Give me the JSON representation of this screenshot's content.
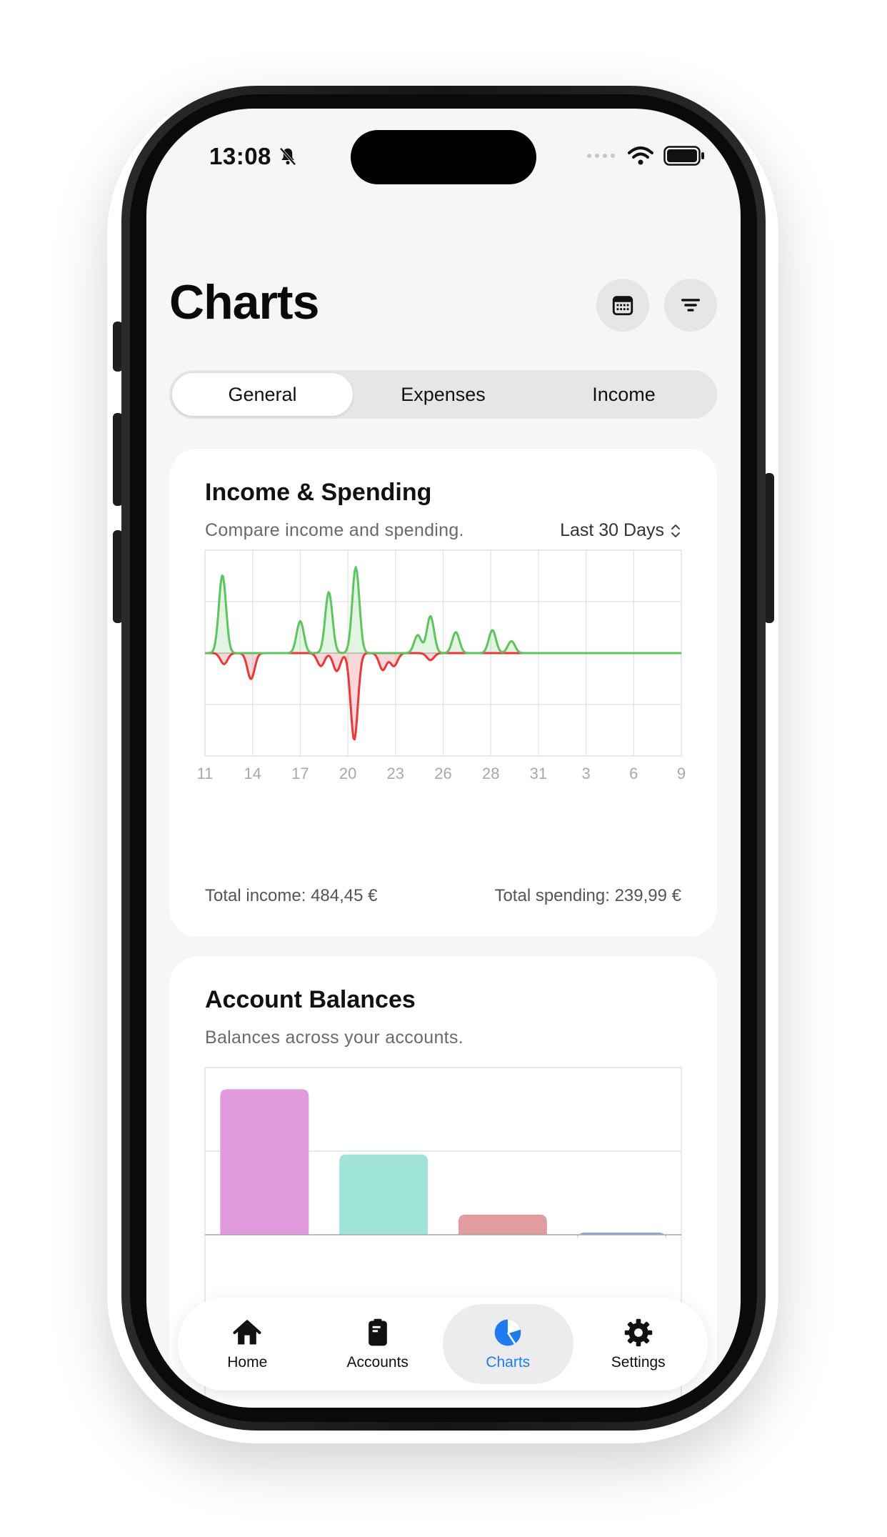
{
  "status_bar": {
    "time": "13:08"
  },
  "header": {
    "title": "Charts"
  },
  "segmented": {
    "items": [
      "General",
      "Expenses",
      "Income"
    ],
    "selected": "General"
  },
  "income_card": {
    "title": "Income & Spending",
    "subtitle": "Compare income and spending.",
    "range_label": "Last 30 Days",
    "total_income": "Total income: 484,45 €",
    "total_spending": "Total spending: 239,99 €"
  },
  "balances_card": {
    "title": "Account Balances",
    "subtitle": "Balances across your accounts."
  },
  "tabbar": {
    "home": "Home",
    "accounts": "Accounts",
    "charts": "Charts",
    "settings": "Settings",
    "selected": "Charts"
  },
  "colors": {
    "income_line": "#5ec45e",
    "spending_line": "#e8383a",
    "accent": "#1e7cf0",
    "bar_colors": [
      "#e19bdc",
      "#a0e4d8",
      "#e19c9d",
      "#8fa5e0"
    ]
  },
  "chart_data": [
    {
      "type": "area",
      "title": "Income & Spending",
      "x_tick_labels": [
        "11",
        "14",
        "17",
        "20",
        "23",
        "26",
        "28",
        "31",
        "3",
        "6",
        "9"
      ],
      "series": [
        {
          "values": [
            [
              12.1,
              0.78
            ],
            [
              17.0,
              0.32
            ],
            [
              18.8,
              0.61
            ],
            [
              20.5,
              0.86
            ],
            [
              24.4,
              0.18
            ],
            [
              25.2,
              0.37
            ],
            [
              26.8,
              0.21
            ],
            [
              29.1,
              0.23
            ],
            [
              30.3,
              0.12
            ]
          ]
        },
        {
          "values": [
            [
              12.2,
              -0.11
            ],
            [
              13.9,
              -0.26
            ],
            [
              18.3,
              -0.13
            ],
            [
              19.3,
              -0.18
            ],
            [
              20.4,
              -0.87
            ],
            [
              22.2,
              -0.17
            ],
            [
              22.9,
              -0.13
            ],
            [
              25.2,
              -0.07
            ]
          ]
        }
      ],
      "grid": true
    },
    {
      "type": "bar",
      "title": "Account Balances",
      "categories": [
        "",
        "",
        "",
        ""
      ],
      "values": [
        0.87,
        0.48,
        0.12,
        0.01
      ],
      "grid": true
    }
  ]
}
